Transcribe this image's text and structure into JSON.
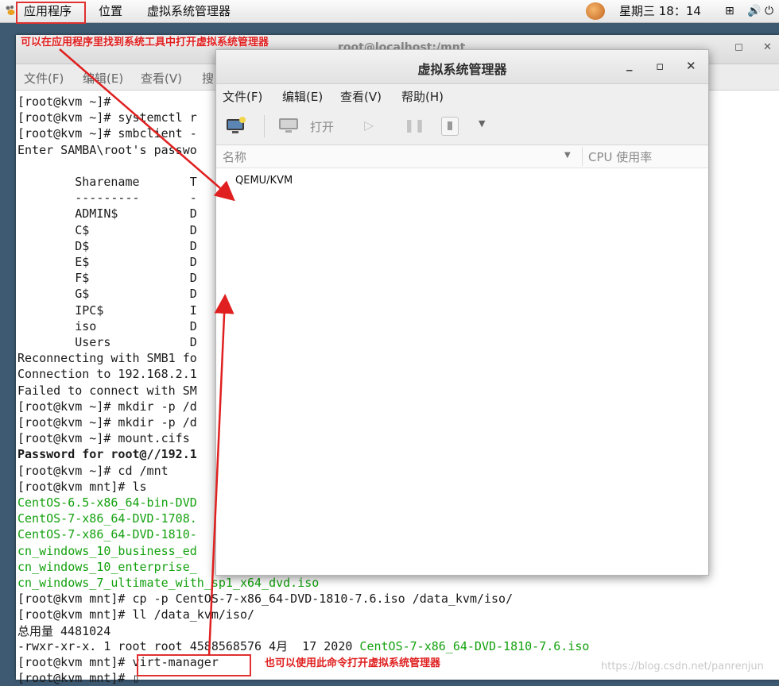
{
  "topbar": {
    "apps_label": "应用程序",
    "places_label": "位置",
    "vmm_label": "虚拟系统管理器",
    "clock": "星期三 18：14"
  },
  "terminal": {
    "title": "root@localhost:/mnt",
    "menu": [
      "文件(F)",
      "编辑(E)",
      "查看(V)",
      "搜"
    ],
    "lines": [
      {
        "text": "[root@kvm ~]#",
        "style": ""
      },
      {
        "text": "[root@kvm ~]# systemctl r",
        "style": ""
      },
      {
        "text": "[root@kvm ~]# smbclient -",
        "style": ""
      },
      {
        "text": "Enter SAMBA\\root's passwo",
        "style": ""
      },
      {
        "text": "",
        "style": ""
      },
      {
        "text": "        Sharename       T",
        "style": ""
      },
      {
        "text": "        ---------       -",
        "style": ""
      },
      {
        "text": "        ADMIN$          D",
        "style": ""
      },
      {
        "text": "        C$              D",
        "style": ""
      },
      {
        "text": "        D$              D",
        "style": ""
      },
      {
        "text": "        E$              D",
        "style": ""
      },
      {
        "text": "        F$              D",
        "style": ""
      },
      {
        "text": "        G$              D",
        "style": ""
      },
      {
        "text": "        IPC$            I",
        "style": ""
      },
      {
        "text": "        iso             D",
        "style": ""
      },
      {
        "text": "        Users           D",
        "style": ""
      },
      {
        "text": "Reconnecting with SMB1 fo",
        "style": ""
      },
      {
        "text": "Connection to 192.168.2.1",
        "style": ""
      },
      {
        "text": "Failed to connect with SM",
        "style": ""
      },
      {
        "text": "[root@kvm ~]# mkdir -p /d",
        "style": ""
      },
      {
        "text": "[root@kvm ~]# mkdir -p /d",
        "style": ""
      },
      {
        "text": "[root@kvm ~]# mount.cifs",
        "style": ""
      },
      {
        "text": "Password for root@//192.1",
        "style": "b"
      },
      {
        "text": "[root@kvm ~]# cd /mnt",
        "style": ""
      },
      {
        "text": "[root@kvm mnt]# ls",
        "style": ""
      },
      {
        "text": "CentOS-6.5-x86_64-bin-DVD",
        "style": "g"
      },
      {
        "text": "CentOS-7-x86_64-DVD-1708.",
        "style": "g"
      },
      {
        "text": "CentOS-7-x86_64-DVD-1810-",
        "style": "g"
      },
      {
        "text": "cn_windows_10_business_ed",
        "style": "g"
      },
      {
        "text": "cn_windows_10_enterprise_",
        "style": "g"
      },
      {
        "text": "cn_windows_7_ultimate_with_sp1_x64_dvd.iso",
        "style": "g"
      },
      {
        "text": "[root@kvm mnt]# cp -p CentOS-7-x86_64-DVD-1810-7.6.iso /data_kvm/iso/",
        "style": ""
      },
      {
        "text": "[root@kvm mnt]# ll /data_kvm/iso/",
        "style": ""
      },
      {
        "text": "总用量 4481024",
        "style": ""
      }
    ],
    "ll_prefix": "-rwxr-xr-x. 1 root root 4588568576 4月  17 2020 ",
    "ll_file": "CentOS-7-x86_64-DVD-1810-7.6.iso",
    "cmd_prompt": "[root@kvm mnt]# ",
    "cmd": "virt-manager",
    "last_prompt": "[root@kvm mnt]# ▯"
  },
  "vmm": {
    "title": "虚拟系统管理器",
    "menu": [
      "文件(F)",
      "编辑(E)",
      "查看(V)",
      "帮助(H)"
    ],
    "open_label": "打开",
    "col_name": "名称",
    "col_cpu": "CPU 使用率",
    "connection": "QEMU/KVM"
  },
  "annotations": {
    "top_note": "可以在应用程序里找到系统工具中打开虚拟系统管理器",
    "bottom_note": "也可以使用此命令打开虚拟系统管理器",
    "color": "#e02020"
  },
  "watermark": "https://blog.csdn.net/panrenjun"
}
